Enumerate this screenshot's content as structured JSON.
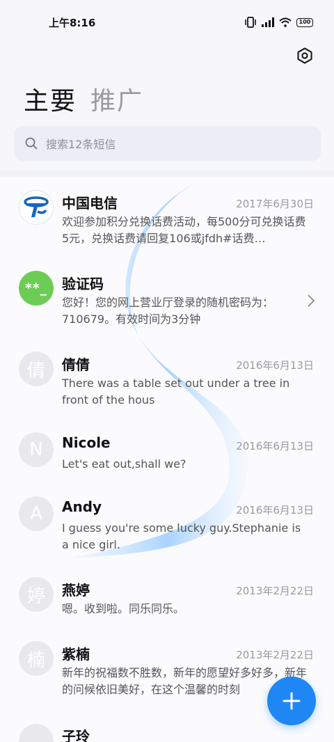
{
  "status_bar": {
    "time": "上午8:16",
    "battery": "100"
  },
  "header": {
    "settings_icon": "gear-hex-icon",
    "tabs": [
      {
        "label": "主要"
      },
      {
        "label": "推广"
      }
    ]
  },
  "search": {
    "placeholder": "搜索12条短信"
  },
  "messages": [
    {
      "name": "中国电信",
      "date": "2017年6月30日",
      "preview": "欢迎参加积分兑换话费活动，每500分可兑换话费5元，兑换话费请回复106或jfdh#话费…",
      "avatar": "telecom-logo"
    },
    {
      "name": "验证码",
      "date": "",
      "preview": "您好！您的网上营业厅登录的随机密码为：710679。有效时间为3分钟",
      "avatar": "**_"
    },
    {
      "name": "倩倩",
      "date": "2016年6月13日",
      "preview": "There was a table set out under a tree in front of the hous",
      "avatar": "倩"
    },
    {
      "name": "Nicole",
      "date": "2016年6月13日",
      "preview": "Let's eat out,shall we?",
      "avatar": "N"
    },
    {
      "name": "Andy",
      "date": "2016年6月13日",
      "preview": "I guess you're some lucky guy.Stephanie is a nice girl.",
      "avatar": "A"
    },
    {
      "name": "燕婷",
      "date": "2013年2月22日",
      "preview": "嗯。收到啦。同乐同乐。",
      "avatar": "婷"
    },
    {
      "name": "紫楠",
      "date": "2013年2月22日",
      "preview": "新年的祝福数不胜数，新年的愿望好多好多，新年的问候依旧美好，在这个温馨的时刻",
      "avatar": "楠"
    },
    {
      "name": "子玲",
      "date": "",
      "preview": "",
      "avatar": ""
    }
  ],
  "fab": {
    "icon": "plus-icon"
  },
  "colors": {
    "accent": "#1f87f4",
    "code_avatar": "#6dcc56",
    "telecom_blue": "#1565c0"
  }
}
